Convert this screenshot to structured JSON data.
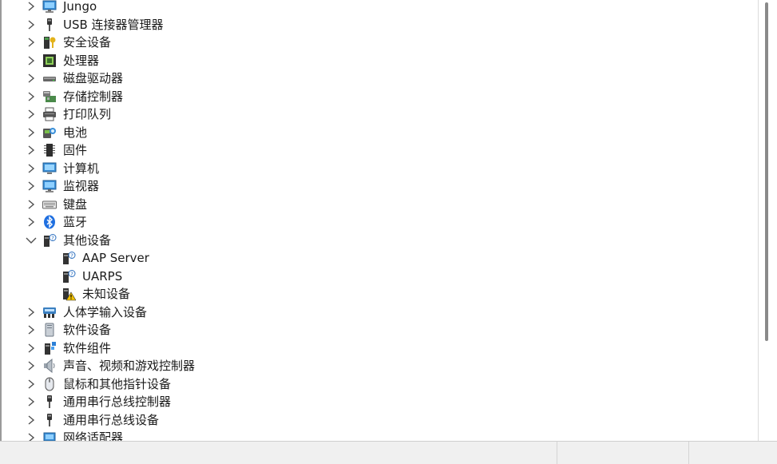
{
  "device_tree": {
    "items": [
      {
        "label": "Jungo",
        "icon": "monitor-icon",
        "state": "collapsed",
        "level": 0
      },
      {
        "label": "USB 连接器管理器",
        "icon": "usb-plug-icon",
        "state": "collapsed",
        "level": 0
      },
      {
        "label": "安全设备",
        "icon": "security-key-icon",
        "state": "collapsed",
        "level": 0
      },
      {
        "label": "处理器",
        "icon": "processor-chip-icon",
        "state": "collapsed",
        "level": 0
      },
      {
        "label": "磁盘驱动器",
        "icon": "disk-drive-icon",
        "state": "collapsed",
        "level": 0
      },
      {
        "label": "存储控制器",
        "icon": "storage-controller-icon",
        "state": "collapsed",
        "level": 0
      },
      {
        "label": "打印队列",
        "icon": "printer-icon",
        "state": "collapsed",
        "level": 0
      },
      {
        "label": "电池",
        "icon": "battery-icon",
        "state": "collapsed",
        "level": 0
      },
      {
        "label": "固件",
        "icon": "firmware-chip-icon",
        "state": "collapsed",
        "level": 0
      },
      {
        "label": "计算机",
        "icon": "computer-icon",
        "state": "collapsed",
        "level": 0
      },
      {
        "label": "监视器",
        "icon": "monitor-icon",
        "state": "collapsed",
        "level": 0
      },
      {
        "label": "键盘",
        "icon": "keyboard-icon",
        "state": "collapsed",
        "level": 0
      },
      {
        "label": "蓝牙",
        "icon": "bluetooth-icon",
        "state": "collapsed",
        "level": 0
      },
      {
        "label": "其他设备",
        "icon": "unknown-device-icon",
        "state": "expanded",
        "level": 0
      },
      {
        "label": "AAP Server",
        "icon": "unknown-device-icon",
        "state": "leaf",
        "level": 1
      },
      {
        "label": "UARPS",
        "icon": "unknown-device-icon",
        "state": "leaf",
        "level": 1
      },
      {
        "label": "未知设备",
        "icon": "warning-device-icon",
        "state": "leaf",
        "level": 1
      },
      {
        "label": "人体学输入设备",
        "icon": "hid-icon",
        "state": "collapsed",
        "level": 0
      },
      {
        "label": "软件设备",
        "icon": "software-device-icon",
        "state": "collapsed",
        "level": 0
      },
      {
        "label": "软件组件",
        "icon": "software-component-icon",
        "state": "collapsed",
        "level": 0
      },
      {
        "label": "声音、视频和游戏控制器",
        "icon": "speaker-icon",
        "state": "collapsed",
        "level": 0
      },
      {
        "label": "鼠标和其他指针设备",
        "icon": "mouse-icon",
        "state": "collapsed",
        "level": 0
      },
      {
        "label": "通用串行总线控制器",
        "icon": "usb-plug-icon",
        "state": "collapsed",
        "level": 0
      },
      {
        "label": "通用串行总线设备",
        "icon": "usb-plug-icon",
        "state": "collapsed",
        "level": 0
      },
      {
        "label": "网络适配器",
        "icon": "network-adapter-icon",
        "state": "collapsed",
        "level": 0
      }
    ]
  },
  "colors": {
    "monitor_blue": "#3a8fd8",
    "bluetooth_blue": "#1f6fe0",
    "warning_yellow": "#f2c200",
    "chevron": "#505050",
    "status_bar": "#f0f0f0"
  }
}
